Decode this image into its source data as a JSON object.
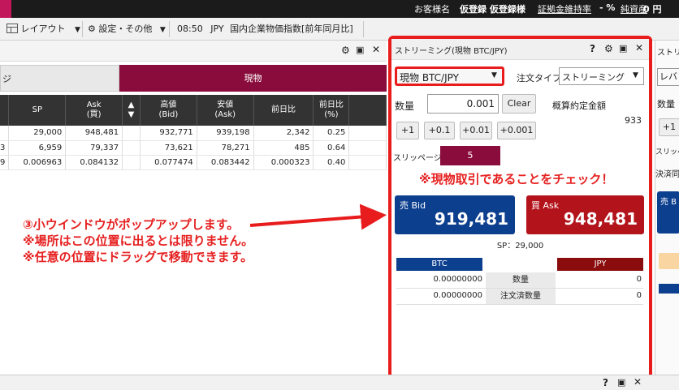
{
  "topbar": {
    "account_prefix": "お客様名",
    "account_name": "仮登録 仮登録様",
    "margin_rate_label": "証拠金維持率",
    "margin_rate_value": "- %",
    "net_assets_label": "純資産",
    "net_assets_value": "0 円"
  },
  "toolbar": {
    "layout_label": "レイアウト",
    "settings_label": "設定・その他",
    "news_time": "08:50",
    "news_ccy": "JPY",
    "news_text": "国内企業物価指数[前年同月比]"
  },
  "tabs": {
    "left_partial": "ジ",
    "spot": "現物"
  },
  "table": {
    "headers": [
      "SP",
      "Ask\n(買)",
      "▲\n▼",
      "高値\n(Bid)",
      "安値\n(Ask)",
      "前日比",
      "前日比\n(%)"
    ],
    "row_prefix": [
      "",
      "3",
      "9"
    ],
    "rows": [
      [
        "29,000",
        "948,481",
        "",
        "932,771",
        "939,198",
        "2,342",
        "0.25"
      ],
      [
        "6,959",
        "79,337",
        "",
        "73,621",
        "78,271",
        "485",
        "0.64"
      ],
      [
        "0.006963",
        "0.084132",
        "",
        "0.077474",
        "0.083442",
        "0.000323",
        "0.40"
      ]
    ]
  },
  "annotation_left": {
    "line1": "③小ウインドウがポップアップします。",
    "line2": "※場所はこの位置に出るとは限りません。",
    "line3": "※任意の位置にドラッグで移動できます。"
  },
  "popup": {
    "title": "ストリーミング(現物 BTC/JPY)",
    "symbol": "現物 BTC/JPY",
    "order_type_label": "注文タイプ",
    "order_type_value": "ストリーミング",
    "qty_label": "数量",
    "qty_value": "0.001",
    "clear_label": "Clear",
    "est_amount_label": "概算約定金額",
    "est_amount_value": "933",
    "step_buttons": [
      "+1",
      "+0.1",
      "+0.01",
      "+0.001"
    ],
    "slippage_label": "スリッページ",
    "slippage_value": "5",
    "annotation": "※現物取引であることをチェック！",
    "sell_label": "売 Bid",
    "sell_price": "919,481",
    "buy_label": "買 Ask",
    "buy_price": "948,481",
    "spread": "SP：29,000",
    "pos_header_left": "BTC",
    "pos_header_right": "JPY",
    "pos_rows": [
      {
        "left": "0.00000000",
        "label": "数量",
        "right": "0"
      },
      {
        "left": "0.00000000",
        "label": "注文済数量",
        "right": "0"
      }
    ]
  },
  "right_popup": {
    "title": "ストリ",
    "row1": "レバ",
    "qty": "数量",
    "btn": "+1",
    "slip": "スリッペ",
    "settle": "決済同",
    "sell": "売 B"
  },
  "colors": {
    "accent_spot": "#8a0c3c",
    "sell_blue": "#0d3f8f",
    "buy_red": "#b3131b",
    "annotation_red": "#e81c1c"
  }
}
